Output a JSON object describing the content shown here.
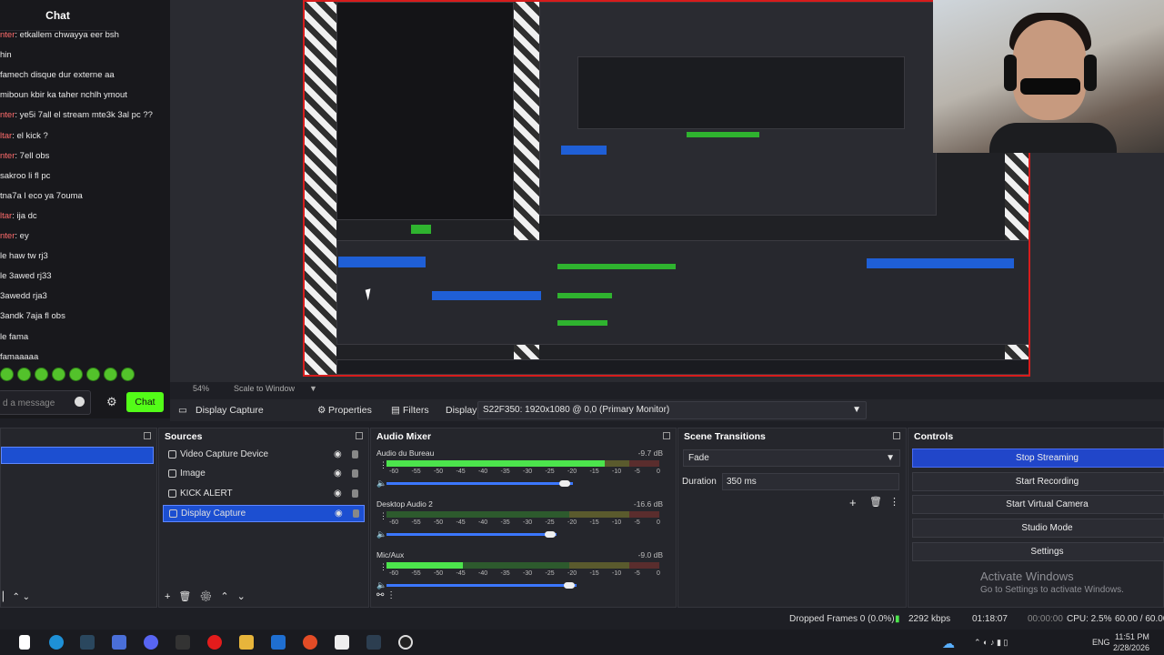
{
  "chat": {
    "title": "Chat",
    "messages": [
      {
        "user": "nter",
        "text": "etkallem chwayya eer bsh"
      },
      {
        "user": "",
        "text": "hin"
      },
      {
        "user": "",
        "text": "famech disque dur externe aa"
      },
      {
        "user": "",
        "text": "miboun kbir ka taher nchlh ymout"
      },
      {
        "user": "nter",
        "text": "ye5i 7all el stream mte3k 3al pc ??"
      },
      {
        "user": "ltar",
        "text": "el kick ?"
      },
      {
        "user": "nter",
        "text": "7ell obs"
      },
      {
        "user": "",
        "text": "sakroo li fl pc"
      },
      {
        "user": "",
        "text": "tna7a l eco ya 7ouma"
      },
      {
        "user": "ltar",
        "text": "ija dc"
      },
      {
        "user": "nter",
        "text": "ey"
      },
      {
        "user": "",
        "text": "le haw tw rj3"
      },
      {
        "user": "",
        "text": "le 3awed rj33"
      },
      {
        "user": "",
        "text": "3awedd rja3"
      },
      {
        "user": "",
        "text": "3andk 7aja fl obs"
      },
      {
        "user": "",
        "text": "le fama"
      },
      {
        "user": "",
        "text": "famaaaaa"
      }
    ],
    "input_placeholder": "d a message",
    "send_label": "Chat"
  },
  "preview": {
    "zoom": "54%",
    "scale_mode": "Scale to Window"
  },
  "toolbar": {
    "source_name": "Display Capture",
    "properties": "Properties",
    "filters": "Filters",
    "display_label": "Display",
    "display_value": "S22F350: 1920x1080 @ 0,0 (Primary Monitor)"
  },
  "sources": {
    "title": "Sources",
    "items": [
      {
        "name": "Video Capture Device",
        "selected": false
      },
      {
        "name": "Image",
        "selected": false
      },
      {
        "name": "KICK ALERT",
        "selected": false
      },
      {
        "name": "Display Capture",
        "selected": true
      }
    ]
  },
  "mixer": {
    "title": "Audio Mixer",
    "ticks": [
      "-60",
      "-55",
      "-50",
      "-45",
      "-40",
      "-35",
      "-30",
      "-25",
      "-20",
      "-15",
      "-10",
      "-5",
      "0"
    ],
    "channels": [
      {
        "name": "Audio du Bureau",
        "db": "-9.7 dB",
        "level": 0.8,
        "volume": 0.93
      },
      {
        "name": "Desktop Audio 2",
        "db": "-16.6 dB",
        "level": 0.0,
        "volume": 0.85
      },
      {
        "name": "Mic/Aux",
        "db": "-9.0 dB",
        "level": 0.28,
        "volume": 0.95
      }
    ]
  },
  "transitions": {
    "title": "Scene Transitions",
    "selected": "Fade",
    "duration_label": "Duration",
    "duration_value": "350 ms"
  },
  "controls": {
    "title": "Controls",
    "buttons": [
      "Stop Streaming",
      "Start Recording",
      "Start Virtual Camera",
      "Studio Mode",
      "Settings"
    ]
  },
  "watermark": {
    "line1": "Activate Windows",
    "line2": "Go to Settings to activate Windows."
  },
  "status": {
    "dropped": "Dropped Frames 0 (0.0%)",
    "bitrate": "2292 kbps",
    "live_time": "01:18:07",
    "rec_time": "00:00:00",
    "cpu": "CPU: 2.5%",
    "fps": "60.00 / 60.00"
  },
  "tray": {
    "lang": "ENG",
    "time": "11:51 PM",
    "date": "2/28/2026"
  }
}
